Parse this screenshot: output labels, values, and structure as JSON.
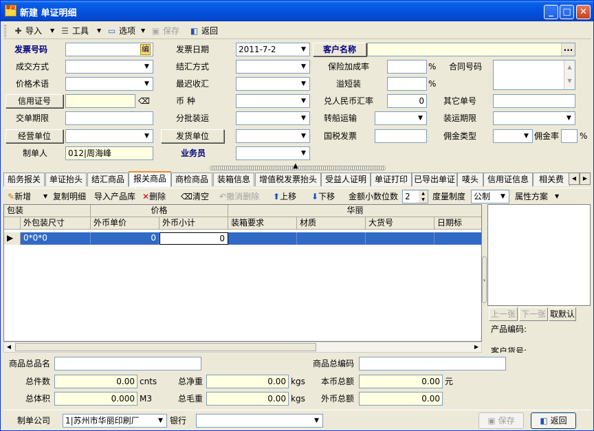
{
  "window": {
    "title": "新建  单证明细",
    "app_icon_text": "单证"
  },
  "toolbar": {
    "import": "导入",
    "tools": "工具",
    "options": "选项",
    "save": "保存",
    "back": "返回"
  },
  "form": {
    "invoice_no": {
      "label": "发票号码",
      "badge": "编",
      "value": ""
    },
    "invoice_date": {
      "label": "发票日期",
      "value": "2011-7-2"
    },
    "customer_name": {
      "label": "客户名称",
      "value": "",
      "ellipsis": "..."
    },
    "deal_method": {
      "label": "成交方式",
      "value": ""
    },
    "settle_method": {
      "label": "结汇方式",
      "value": ""
    },
    "insurance_rate": {
      "label": "保险加成率",
      "value": "",
      "unit": "%"
    },
    "contract_no": {
      "label": "合同号码",
      "value": ""
    },
    "price_term": {
      "label": "价格术语",
      "value": ""
    },
    "latest_settle": {
      "label": "最迟收汇",
      "value": ""
    },
    "overshort": {
      "label": "溢短装",
      "value": "",
      "unit": "%"
    },
    "lc_no": {
      "label": "信用证号",
      "value": ""
    },
    "currency": {
      "label": "币     种",
      "value": ""
    },
    "rmb_rate": {
      "label": "兑人民币汇率",
      "value": "0"
    },
    "other_no": {
      "label": "其它单号",
      "value": ""
    },
    "delivery_term": {
      "label": "交单期限",
      "value": ""
    },
    "partial_ship": {
      "label": "分批装运",
      "value": ""
    },
    "transship": {
      "label": "转船运输",
      "value": ""
    },
    "ship_term": {
      "label": "装运期限",
      "value": ""
    },
    "operator_unit": {
      "label": "经营单位",
      "value": ""
    },
    "shipper_unit": {
      "label": "发货单位",
      "value": ""
    },
    "tax_invoice": {
      "label": "国税发票",
      "value": ""
    },
    "commission_type": {
      "label": "佣金类型",
      "value": ""
    },
    "commission_rate": {
      "label": "佣金率",
      "value": "",
      "unit": "%"
    },
    "maker": {
      "label": "制单人",
      "value": "012|周海峰"
    },
    "salesman": {
      "label": "业务员",
      "value": ""
    }
  },
  "tabs": [
    {
      "label": "船务报关"
    },
    {
      "label": "单证抬头"
    },
    {
      "label": "结汇商品"
    },
    {
      "label": "报关商品",
      "active": true
    },
    {
      "label": "商检商品"
    },
    {
      "label": "装箱信息"
    },
    {
      "label": "增值税发票抬头"
    },
    {
      "label": "受益人证明"
    },
    {
      "label": "单证打印"
    },
    {
      "label": "已导出单证"
    },
    {
      "label": "唛头"
    },
    {
      "label": "信用证信息"
    },
    {
      "label": "相关费"
    }
  ],
  "subtoolbar": {
    "add": "新增",
    "copy": "复制明细",
    "import_lib": "导入产品库",
    "delete": "删除",
    "clear": "清空",
    "undo_delete": "撤消删除",
    "up": "上移",
    "down": "下移",
    "decimals_label": "金额小数位数",
    "decimals_value": "2",
    "measure_label": "度量制度",
    "measure_value": "公制",
    "attr_scheme": "属性方案"
  },
  "grid": {
    "group_headers": [
      "包装",
      "价格",
      "华丽"
    ],
    "columns": [
      "外包装尺寸",
      "外币单价",
      "外币小计",
      "装箱要求",
      "材质",
      "大货号",
      "日期标"
    ],
    "rows": [
      {
        "size": "0*0*0",
        "unit_price": "0",
        "subtotal": "0",
        "packing": "",
        "material": "",
        "bulk_no": "",
        "date_mark": ""
      }
    ]
  },
  "right_panel": {
    "prev": "上一张",
    "next": "下一张",
    "default": "取默认",
    "product_code_label": "产品编码:",
    "customer_code_label": "客户货号:"
  },
  "summary": {
    "product_name": {
      "label": "商品总品名",
      "value": ""
    },
    "product_code": {
      "label": "商品总编码",
      "value": ""
    },
    "total_pieces": {
      "label": "总件数",
      "value": "0.00",
      "unit": "cnts"
    },
    "net_weight": {
      "label": "总净重",
      "value": "0.00",
      "unit": "kgs"
    },
    "local_total": {
      "label": "本币总额",
      "value": "0.00",
      "unit": "元"
    },
    "volume": {
      "label": "总体积",
      "value": "0.000",
      "unit": "M3"
    },
    "gross_weight": {
      "label": "总毛重",
      "value": "0.00",
      "unit": "kgs"
    },
    "foreign_total": {
      "label": "外币总额",
      "value": "0.00"
    }
  },
  "footer": {
    "company_label": "制单公司",
    "company_value": "1|苏州市华丽印刷厂",
    "bank_label": "银行",
    "bank_value": "",
    "save": "保存",
    "back": "返回"
  },
  "colors": {
    "title_bar": "#0453dc",
    "selection": "#316ac5",
    "field_highlight": "#ffffe1",
    "label_blue": "#000080"
  }
}
